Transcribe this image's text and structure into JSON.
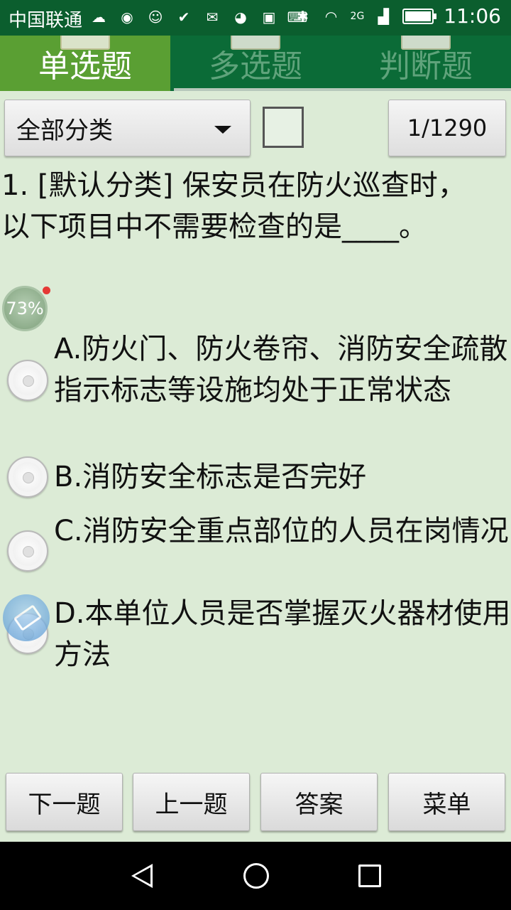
{
  "status_bar": {
    "carrier": "中国联通",
    "time": "11:06",
    "network": "2G",
    "icons": [
      "weather-icon",
      "app-icon",
      "face-icon",
      "signal-app-icon",
      "mail-icon",
      "browser-icon",
      "image-icon",
      "keyboard-icon",
      "bluetooth-icon",
      "wifi-icon",
      "cellular-icon",
      "battery-icon"
    ]
  },
  "tabs": [
    {
      "label": "单选题",
      "active": true
    },
    {
      "label": "多选题",
      "active": false
    },
    {
      "label": "判断题",
      "active": false
    }
  ],
  "controls": {
    "category": "全部分类",
    "counter": "1/1290"
  },
  "progress_badge": "73%",
  "question": {
    "text": "1. [默认分类] 保安员在防火巡查时，以下项目中不需要检查的是____。"
  },
  "options": [
    {
      "text": "A.防火门、防火卷帘、消防安全疏散指示标志等设施均处于正常状态"
    },
    {
      "text": "B.消防安全标志是否完好"
    },
    {
      "text": "C.消防安全重点部位的人员在岗情况"
    },
    {
      "text": "D.本单位人员是否掌握灭火器材使用方法"
    }
  ],
  "buttons": {
    "next": "下一题",
    "prev": "上一题",
    "answer": "答案",
    "menu": "菜单"
  },
  "colors": {
    "status_bar": "#0b5e2e",
    "tab_bar": "#0b6b37",
    "tab_active": "#5a9f33",
    "background": "#dcebd6"
  }
}
